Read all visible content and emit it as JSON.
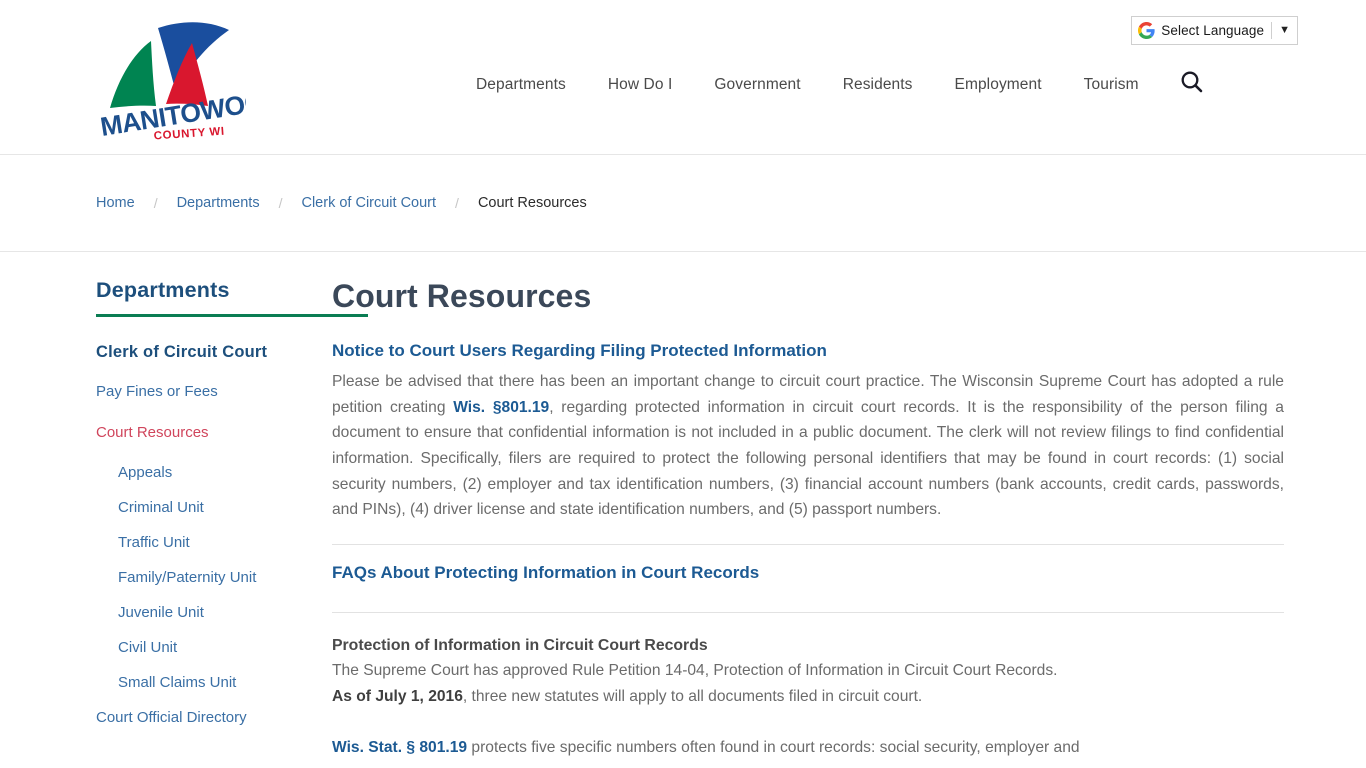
{
  "header": {
    "logo": {
      "wordmark": "MANITOWOC",
      "subtitle": "COUNTY WI",
      "colors": {
        "green": "#008451",
        "blue": "#1a4e9e",
        "red": "#d9172e",
        "wordmark": "#1d4f8c"
      }
    },
    "language_widget": {
      "icon": "google-g-icon",
      "label": "Select Language",
      "caret": "▼"
    },
    "nav": [
      {
        "label": "Departments"
      },
      {
        "label": "How Do I"
      },
      {
        "label": "Government"
      },
      {
        "label": "Residents"
      },
      {
        "label": "Employment"
      },
      {
        "label": "Tourism"
      }
    ],
    "search_icon": "search-icon"
  },
  "breadcrumb": {
    "separator": "/",
    "items": [
      {
        "label": "Home",
        "current": false
      },
      {
        "label": "Departments",
        "current": false
      },
      {
        "label": "Clerk of Circuit Court",
        "current": false
      },
      {
        "label": "Court Resources",
        "current": true
      }
    ]
  },
  "sidebar": {
    "title": "Departments",
    "section_heading": "Clerk of Circuit Court",
    "items": [
      {
        "label": "Pay Fines or Fees",
        "level": 1,
        "active": false
      },
      {
        "label": "Court Resources",
        "level": 1,
        "active": true
      },
      {
        "label": "Appeals",
        "level": 2,
        "active": false
      },
      {
        "label": "Criminal Unit",
        "level": 2,
        "active": false
      },
      {
        "label": "Traffic Unit",
        "level": 2,
        "active": false
      },
      {
        "label": "Family/Paternity Unit",
        "level": 2,
        "active": false
      },
      {
        "label": "Juvenile Unit",
        "level": 2,
        "active": false
      },
      {
        "label": "Civil Unit",
        "level": 2,
        "active": false
      },
      {
        "label": "Small Claims Unit",
        "level": 2,
        "active": false
      },
      {
        "label": "Court Official Directory",
        "level": 1,
        "active": false
      }
    ],
    "accent_color": "#0a7d53",
    "active_color": "#d0455c"
  },
  "main": {
    "title": "Court Resources",
    "notice": {
      "link_heading": "Notice to Court Users Regarding Filing Protected Information",
      "paragraph_before": "Please be advised that there has been an important change to circuit court practice.  The Wisconsin Supreme Court has adopted a rule petition creating ",
      "inline_link": "Wis. §801.19",
      "paragraph_after": ", regarding protected information in circuit court records.  It is the responsibility of the person filing a document to ensure that confidential information is not included in a public document.  The clerk will not review filings to find confidential information.  Specifically, filers are required to protect the following personal identifiers that may be found in court records:  (1) social security numbers, (2) employer and tax identification numbers, (3) financial account numbers (bank accounts, credit cards, passwords, and PINs), (4) driver license and state identification numbers, and (5) passport numbers."
    },
    "faq_link": "FAQs About Protecting Information in Court Records",
    "protection": {
      "heading": "Protection of Information in Circuit Court Records",
      "line1": "The Supreme Court has approved Rule Petition 14-04, Protection of Information in Circuit Court Records.",
      "line2_bold": "As of July 1, 2016",
      "line2_rest": ", three new statutes will apply to all documents filed in circuit court."
    },
    "statute": {
      "link": "Wis. Stat. § 801.19",
      "text": " protects five specific numbers often found in court records: social security, employer and"
    }
  }
}
